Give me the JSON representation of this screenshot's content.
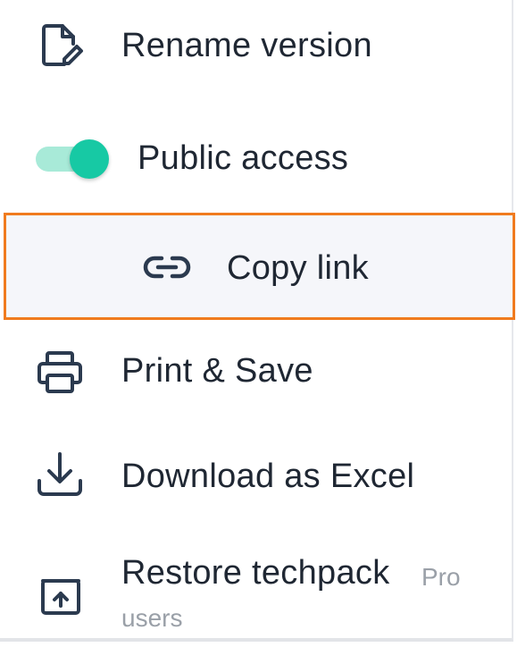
{
  "menu": {
    "items": [
      {
        "label": "Rename version",
        "icon": "rename-file-icon"
      },
      {
        "label": "Public access",
        "icon": "toggle-switch",
        "toggle_on": true
      },
      {
        "label": "Copy link",
        "icon": "link-icon"
      },
      {
        "label": "Print & Save",
        "icon": "printer-icon"
      },
      {
        "label": "Download as Excel",
        "icon": "download-icon"
      },
      {
        "label": "Restore techpack",
        "icon": "restore-box-icon",
        "badge_part1": "Pro",
        "badge_part2": "users"
      }
    ]
  },
  "colors": {
    "text": "#1f2733",
    "icon": "#2b3a4f",
    "toggle_knob": "#17c9a4",
    "toggle_track": "#a8ead8",
    "highlight_border": "#f07b1e",
    "highlight_bg": "#f5f6fa",
    "muted_text": "#9aa0a8"
  }
}
